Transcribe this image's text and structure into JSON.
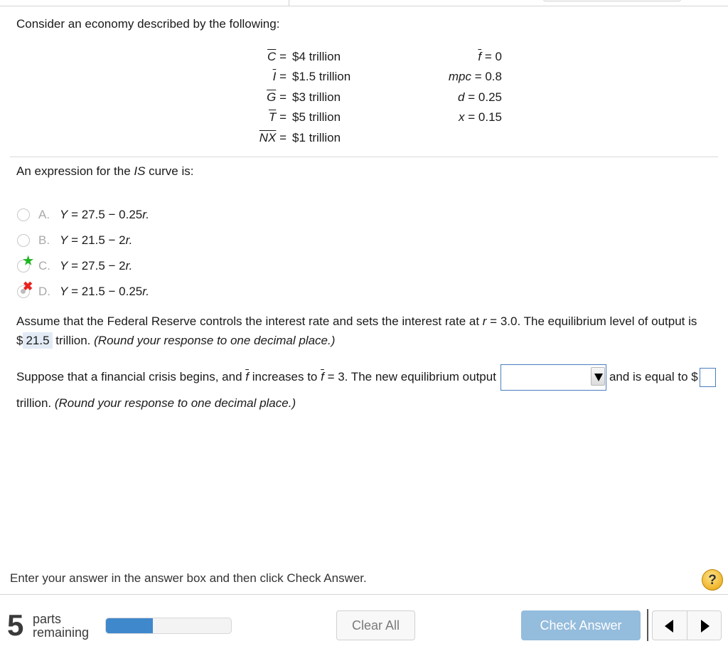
{
  "intro": "Consider an economy described by the following:",
  "givens": [
    {
      "symbol": "C",
      "eq": "=",
      "value": "$4 trillion"
    },
    {
      "symbol": "I",
      "eq": "=",
      "value": "$1.5 trillion"
    },
    {
      "symbol": "G",
      "eq": "=",
      "value": "$3 trillion"
    },
    {
      "symbol": "T",
      "eq": "=",
      "value": "$5 trillion"
    },
    {
      "symbol": "NX",
      "eq": "=",
      "value": "$1 trillion"
    }
  ],
  "params": [
    {
      "symbol": "f",
      "value": "= 0"
    },
    {
      "symbol": "mpc",
      "value": "= 0.8"
    },
    {
      "symbol": "d",
      "value": "= 0.25"
    },
    {
      "symbol": "x",
      "value": "= 0.15"
    }
  ],
  "question": {
    "prefix": "An expression for the ",
    "term": "IS",
    "suffix": " curve is:"
  },
  "options": [
    {
      "letter": "A.",
      "y": "Y",
      "expr": " = 27.5 − 0.25",
      "r": "r.",
      "state": "none"
    },
    {
      "letter": "B.",
      "y": "Y",
      "expr": " = 21.5 − 2",
      "r": "r.",
      "state": "none"
    },
    {
      "letter": "C.",
      "y": "Y",
      "expr": " = 27.5 − 2",
      "r": "r.",
      "state": "correct",
      "mark": "★"
    },
    {
      "letter": "D.",
      "y": "Y",
      "expr": " = 21.5 − 0.25",
      "r": "r.",
      "state": "selected-wrong",
      "mark": "✖"
    }
  ],
  "part2": {
    "text1": "Assume that the Federal Reserve controls the interest rate and sets the interest rate at ",
    "r": "r",
    "text2": " = 3.0. The equilibrium level of output is $",
    "answer": "21.5",
    "text3": " trillion. ",
    "hint": "(Round your response to one decimal place.)"
  },
  "part3": {
    "text1": "Suppose that a financial crisis begins, and ",
    "f1": "f",
    "text2": " increases to ",
    "f2": "f",
    "text3": " = 3. The new equilibrium output",
    "dropdown_value": "",
    "text4": "and is equal to $",
    "answer_value": "",
    "text5": "trillion. ",
    "hint": "(Round your response to one decimal place.)"
  },
  "footer": {
    "instruction": "Enter your answer in the answer box and then click Check Answer.",
    "help_label": "?",
    "parts_count": "5",
    "parts_line1": "parts",
    "parts_line2": "remaining",
    "progress_fraction": 0.375,
    "clear_label": "Clear All",
    "check_label": "Check Answer"
  }
}
